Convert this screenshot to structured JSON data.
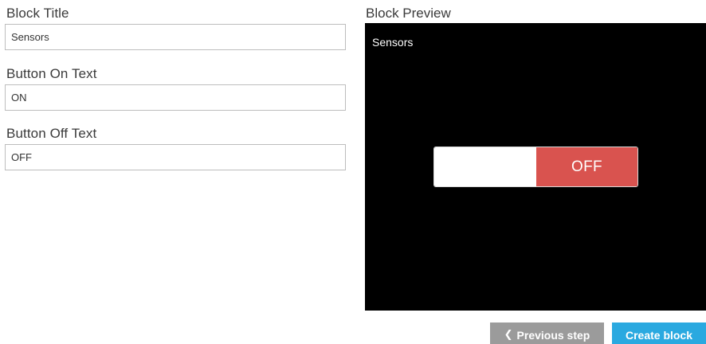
{
  "form": {
    "block_title": {
      "label": "Block Title",
      "value": "Sensors"
    },
    "button_on_text": {
      "label": "Button On Text",
      "value": "ON"
    },
    "button_off_text": {
      "label": "Button Off Text",
      "value": "OFF"
    }
  },
  "preview": {
    "label": "Block Preview",
    "title": "Sensors",
    "toggle_state": "off",
    "toggle_off_label": "OFF",
    "toggle_off_color": "#d9534f"
  },
  "actions": {
    "previous_label": "Previous step",
    "previous_icon": "chevron-left-icon",
    "create_label": "Create block",
    "create_color": "#2aa9e0",
    "previous_color": "#9b9b9b"
  }
}
